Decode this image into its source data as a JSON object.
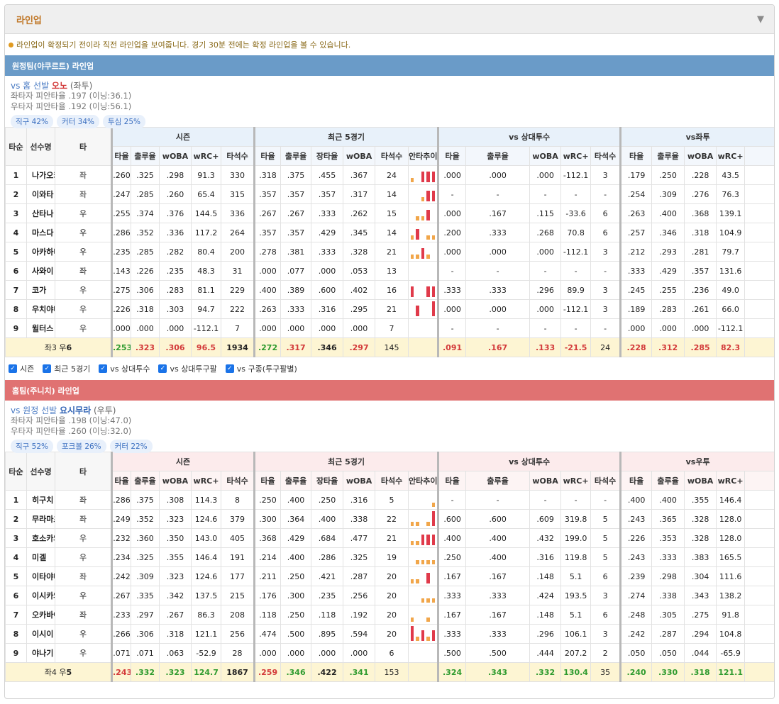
{
  "panel": {
    "title": "라인업",
    "toggle_icon": "triangle-down-icon"
  },
  "notice": "라인업이 확정되기 전이라 직전 라인업을 보여줍니다. 경기 30분 전에는 확정 라인업을 볼 수 있습니다.",
  "group_labels": {
    "season": "시즌",
    "recent": "최근 5경기",
    "vs_pitcher": "vs 상대투수"
  },
  "fixed_headers": {
    "order": "타순",
    "name": "선수명",
    "hand": "타"
  },
  "season_cols": [
    "타율",
    "출루율",
    "wOBA",
    "wRC+",
    "타석수"
  ],
  "recent_cols": [
    "타율",
    "출루율",
    "장타율",
    "wOBA",
    "타석수",
    "안타추이"
  ],
  "vsp_cols": [
    "타율",
    "출루율",
    "wOBA",
    "wRC+",
    "타석수"
  ],
  "hand_cols": [
    "타율",
    "출루율",
    "wOBA",
    "wRC+"
  ],
  "filters": [
    {
      "label": "시즌",
      "checked": true
    },
    {
      "label": "최근 5경기",
      "checked": true
    },
    {
      "label": "vs 상대투수",
      "checked": true
    },
    {
      "label": "vs 상대투구팔",
      "checked": true
    },
    {
      "label": "vs 구종(투구팔별)",
      "checked": true
    }
  ],
  "away": {
    "title": "원정팀(야쿠르트) 라인업",
    "sp_prefix": "vs 홈 선발 ",
    "sp_name": "오노",
    "sp_hand": "(좌투)",
    "sp_lhb": "좌타자 피안타율 .197 (이닝:36.1)",
    "sp_rhb": "우타자 피안타율 .192 (이닝:56.1)",
    "chips": [
      "직구 42%",
      "커터 34%",
      "투심 25%"
    ],
    "hand_group": "vs좌투",
    "rows": [
      {
        "o": "1",
        "n": "나가오카",
        "h": "좌",
        "s": [
          ".260",
          ".325",
          ".298",
          "91.3",
          "330"
        ],
        "r": [
          ".318",
          ".375",
          ".455",
          ".367",
          "24"
        ],
        "t": [
          1,
          0,
          2,
          2,
          2
        ],
        "v": [
          ".000",
          ".000",
          ".000",
          "-112.1",
          "3"
        ],
        "x": [
          ".179",
          ".250",
          ".228",
          "43.5"
        ]
      },
      {
        "o": "2",
        "n": "이와타",
        "h": "좌",
        "s": [
          ".247",
          ".285",
          ".260",
          "65.4",
          "315"
        ],
        "r": [
          ".357",
          ".357",
          ".357",
          ".317",
          "14"
        ],
        "t": [
          0,
          0,
          1,
          2,
          2
        ],
        "v": [
          "-",
          "-",
          "-",
          "-",
          "-"
        ],
        "x": [
          ".254",
          ".309",
          ".276",
          "76.3"
        ]
      },
      {
        "o": "3",
        "n": "산타나",
        "h": "우",
        "s": [
          ".255",
          ".374",
          ".376",
          "144.5",
          "336"
        ],
        "r": [
          ".267",
          ".267",
          ".333",
          ".262",
          "15"
        ],
        "t": [
          0,
          1,
          1,
          2,
          0
        ],
        "v": [
          ".000",
          ".167",
          ".115",
          "-33.6",
          "6"
        ],
        "x": [
          ".263",
          ".400",
          ".368",
          "139.1"
        ]
      },
      {
        "o": "4",
        "n": "마스다",
        "h": "우",
        "s": [
          ".286",
          ".352",
          ".336",
          "117.2",
          "264"
        ],
        "r": [
          ".357",
          ".357",
          ".429",
          ".345",
          "14"
        ],
        "t": [
          1,
          2,
          0,
          1,
          1
        ],
        "v": [
          ".200",
          ".333",
          ".268",
          "70.8",
          "6"
        ],
        "x": [
          ".257",
          ".346",
          ".318",
          "104.9"
        ]
      },
      {
        "o": "5",
        "n": "아카하네",
        "h": "우",
        "s": [
          ".235",
          ".285",
          ".282",
          "80.4",
          "200"
        ],
        "r": [
          ".278",
          ".381",
          ".333",
          ".328",
          "21"
        ],
        "t": [
          1,
          1,
          2,
          1,
          0
        ],
        "v": [
          ".000",
          ".000",
          ".000",
          "-112.1",
          "3"
        ],
        "x": [
          ".212",
          ".293",
          ".281",
          "79.7"
        ]
      },
      {
        "o": "6",
        "n": "사와이",
        "h": "좌",
        "s": [
          ".143",
          ".226",
          ".235",
          "48.3",
          "31"
        ],
        "r": [
          ".000",
          ".077",
          ".000",
          ".053",
          "13"
        ],
        "t": [
          0,
          0,
          0,
          0,
          0
        ],
        "v": [
          "-",
          "-",
          "-",
          "-",
          "-"
        ],
        "x": [
          ".333",
          ".429",
          ".357",
          "131.6"
        ]
      },
      {
        "o": "7",
        "n": "코가",
        "h": "우",
        "s": [
          ".275",
          ".306",
          ".283",
          "81.1",
          "229"
        ],
        "r": [
          ".400",
          ".389",
          ".600",
          ".402",
          "16"
        ],
        "t": [
          2,
          0,
          0,
          2,
          2
        ],
        "v": [
          ".333",
          ".333",
          ".296",
          "89.9",
          "3"
        ],
        "x": [
          ".245",
          ".255",
          ".236",
          "49.0"
        ]
      },
      {
        "o": "8",
        "n": "우치야마",
        "h": "우",
        "s": [
          ".226",
          ".318",
          ".303",
          "94.7",
          "222"
        ],
        "r": [
          ".263",
          ".333",
          ".316",
          ".295",
          "21"
        ],
        "t": [
          0,
          2,
          0,
          0,
          3
        ],
        "v": [
          ".000",
          ".000",
          ".000",
          "-112.1",
          "3"
        ],
        "x": [
          ".189",
          ".283",
          ".261",
          "66.0"
        ]
      },
      {
        "o": "9",
        "n": "윌터스",
        "h": "우",
        "s": [
          ".000",
          ".000",
          ".000",
          "-112.1",
          "7"
        ],
        "r": [
          ".000",
          ".000",
          ".000",
          ".000",
          "7"
        ],
        "t": [
          0,
          0,
          0,
          0,
          0
        ],
        "v": [
          "-",
          "-",
          "-",
          "-",
          "-"
        ],
        "x": [
          ".000",
          ".000",
          ".000",
          "-112.1"
        ]
      }
    ],
    "total": {
      "label_l": "좌3 우",
      "label_r": "6",
      "s": [
        ".253",
        ".323",
        ".306",
        "96.5",
        "1934"
      ],
      "r": [
        ".272",
        ".317",
        ".346",
        ".297",
        "145"
      ],
      "v": [
        ".091",
        ".167",
        ".133",
        "-21.5",
        "24"
      ],
      "x": [
        ".228",
        ".312",
        ".285",
        "82.3"
      ]
    }
  },
  "home": {
    "title": "홈팀(주니치) 라인업",
    "sp_prefix": "vs 원정 선발 ",
    "sp_name": "요시무라",
    "sp_hand": "(우투)",
    "sp_lhb": "좌타자 피안타율 .198 (이닝:47.0)",
    "sp_rhb": "우타자 피안타율 .260 (이닝:32.0)",
    "chips": [
      "직구 52%",
      "포크볼 26%",
      "커터 22%"
    ],
    "hand_group": "vs우투",
    "rows": [
      {
        "o": "1",
        "n": "히구치",
        "h": "좌",
        "s": [
          ".286",
          ".375",
          ".308",
          "114.3",
          "8"
        ],
        "r": [
          ".250",
          ".400",
          ".250",
          ".316",
          "5"
        ],
        "t": [
          0,
          0,
          0,
          0,
          1
        ],
        "v": [
          "-",
          "-",
          "-",
          "-",
          "-"
        ],
        "x": [
          ".400",
          ".400",
          ".355",
          "146.4"
        ]
      },
      {
        "o": "2",
        "n": "무라마츠",
        "h": "좌",
        "s": [
          ".249",
          ".352",
          ".323",
          "124.6",
          "379"
        ],
        "r": [
          ".300",
          ".364",
          ".400",
          ".338",
          "22"
        ],
        "t": [
          1,
          1,
          0,
          1,
          3
        ],
        "v": [
          ".600",
          ".600",
          ".609",
          "319.8",
          "5"
        ],
        "x": [
          ".243",
          ".365",
          ".328",
          "128.0"
        ]
      },
      {
        "o": "3",
        "n": "호소카와",
        "h": "우",
        "s": [
          ".232",
          ".360",
          ".350",
          "143.0",
          "405"
        ],
        "r": [
          ".368",
          ".429",
          ".684",
          ".477",
          "21"
        ],
        "t": [
          1,
          1,
          2,
          2,
          2
        ],
        "v": [
          ".400",
          ".400",
          ".432",
          "199.0",
          "5"
        ],
        "x": [
          ".226",
          ".353",
          ".328",
          "128.0"
        ]
      },
      {
        "o": "4",
        "n": "미겔",
        "h": "우",
        "s": [
          ".234",
          ".325",
          ".355",
          "146.4",
          "191"
        ],
        "r": [
          ".214",
          ".400",
          ".286",
          ".325",
          "19"
        ],
        "t": [
          0,
          1,
          1,
          1,
          1
        ],
        "v": [
          ".250",
          ".400",
          ".316",
          "119.8",
          "5"
        ],
        "x": [
          ".243",
          ".333",
          ".383",
          "165.5"
        ]
      },
      {
        "o": "5",
        "n": "이타야마",
        "h": "좌",
        "s": [
          ".242",
          ".309",
          ".323",
          "124.6",
          "177"
        ],
        "r": [
          ".211",
          ".250",
          ".421",
          ".287",
          "20"
        ],
        "t": [
          1,
          1,
          0,
          2,
          0
        ],
        "v": [
          ".167",
          ".167",
          ".148",
          "5.1",
          "6"
        ],
        "x": [
          ".239",
          ".298",
          ".304",
          "111.6"
        ]
      },
      {
        "o": "6",
        "n": "이시카와",
        "h": "우",
        "s": [
          ".267",
          ".335",
          ".342",
          "137.5",
          "215"
        ],
        "r": [
          ".176",
          ".300",
          ".235",
          ".256",
          "20"
        ],
        "t": [
          0,
          0,
          1,
          1,
          1
        ],
        "v": [
          ".333",
          ".333",
          ".424",
          "193.5",
          "3"
        ],
        "x": [
          ".274",
          ".338",
          ".343",
          "138.2"
        ]
      },
      {
        "o": "7",
        "n": "오카바야시",
        "h": "좌",
        "s": [
          ".233",
          ".297",
          ".267",
          "86.3",
          "208"
        ],
        "r": [
          ".118",
          ".250",
          ".118",
          ".192",
          "20"
        ],
        "t": [
          1,
          0,
          0,
          1,
          0
        ],
        "v": [
          ".167",
          ".167",
          ".148",
          "5.1",
          "6"
        ],
        "x": [
          ".248",
          ".305",
          ".275",
          "91.8"
        ]
      },
      {
        "o": "8",
        "n": "이시이",
        "h": "우",
        "s": [
          ".266",
          ".306",
          ".318",
          "121.1",
          "256"
        ],
        "r": [
          ".474",
          ".500",
          ".895",
          ".594",
          "20"
        ],
        "t": [
          3,
          1,
          2,
          1,
          2
        ],
        "v": [
          ".333",
          ".333",
          ".296",
          "106.1",
          "3"
        ],
        "x": [
          ".242",
          ".287",
          ".294",
          "104.8"
        ]
      },
      {
        "o": "9",
        "n": "야나기",
        "h": "우",
        "s": [
          ".071",
          ".071",
          ".063",
          "-52.9",
          "28"
        ],
        "r": [
          ".000",
          ".000",
          ".000",
          ".000",
          "6"
        ],
        "t": [
          0,
          0,
          0,
          0,
          0
        ],
        "v": [
          ".500",
          ".500",
          ".444",
          "207.2",
          "2"
        ],
        "x": [
          ".050",
          ".050",
          ".044",
          "-65.9"
        ]
      }
    ],
    "total": {
      "label_l": "좌4 우",
      "label_r": "5",
      "s": [
        ".243",
        ".332",
        ".323",
        "124.7",
        "1867"
      ],
      "r": [
        ".259",
        ".346",
        ".422",
        ".341",
        "153"
      ],
      "v": [
        ".324",
        ".343",
        ".332",
        "130.4",
        "35"
      ],
      "x": [
        ".240",
        ".330",
        ".318",
        "121.1"
      ]
    }
  }
}
